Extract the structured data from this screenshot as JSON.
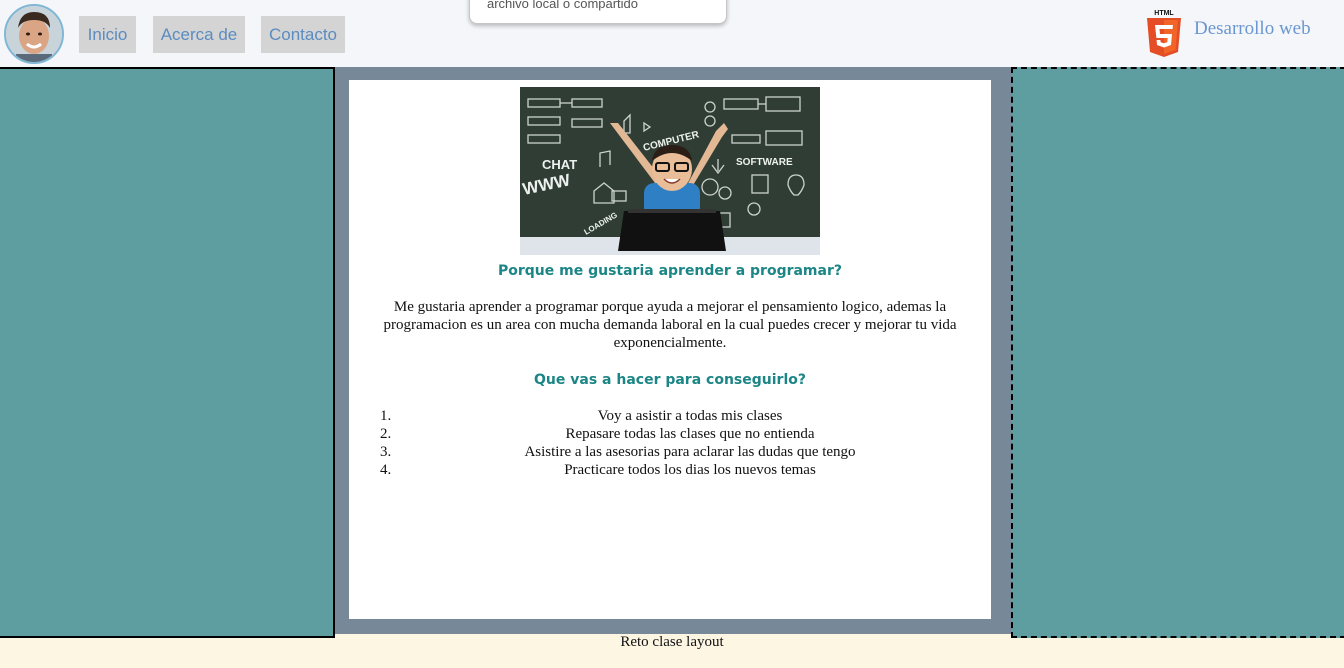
{
  "header": {
    "nav": [
      "Inicio",
      "Acerca de",
      "Contacto"
    ],
    "tooltip_text": "archivo local o compartido",
    "brand": "Desarrollo web",
    "logo_label": "HTML"
  },
  "content": {
    "hero_words": [
      "CHAT",
      "WWW",
      "COMPUTER",
      "SOFTWARE",
      "LOADING"
    ],
    "heading1": "Porque me gustaria aprender a programar?",
    "paragraph": "Me gustaria aprender a programar porque ayuda a mejorar el pensamiento logico, ademas la programacion es un area con mucha demanda laboral en la cual puedes crecer y mejorar tu vida exponencialmente.",
    "heading2": "Que vas a hacer para conseguirlo?",
    "list": [
      {
        "num": "1.",
        "text": "Voy a asistir a todas mis clases"
      },
      {
        "num": "2.",
        "text": "Repasare todas las clases que no entienda"
      },
      {
        "num": "3.",
        "text": "Asistire a las asesorias para aclarar las dudas que tengo"
      },
      {
        "num": "4.",
        "text": "Practicare todos los dias los nuevos temas"
      }
    ]
  },
  "footer": {
    "text": "Reto clase layout"
  },
  "colors": {
    "teal": "#5f9ea0",
    "slate": "#778899",
    "heading": "#1c8585",
    "nav_text": "#5b8cc0",
    "footer_bg": "#fdf6e3",
    "html5_orange": "#e44d26"
  }
}
